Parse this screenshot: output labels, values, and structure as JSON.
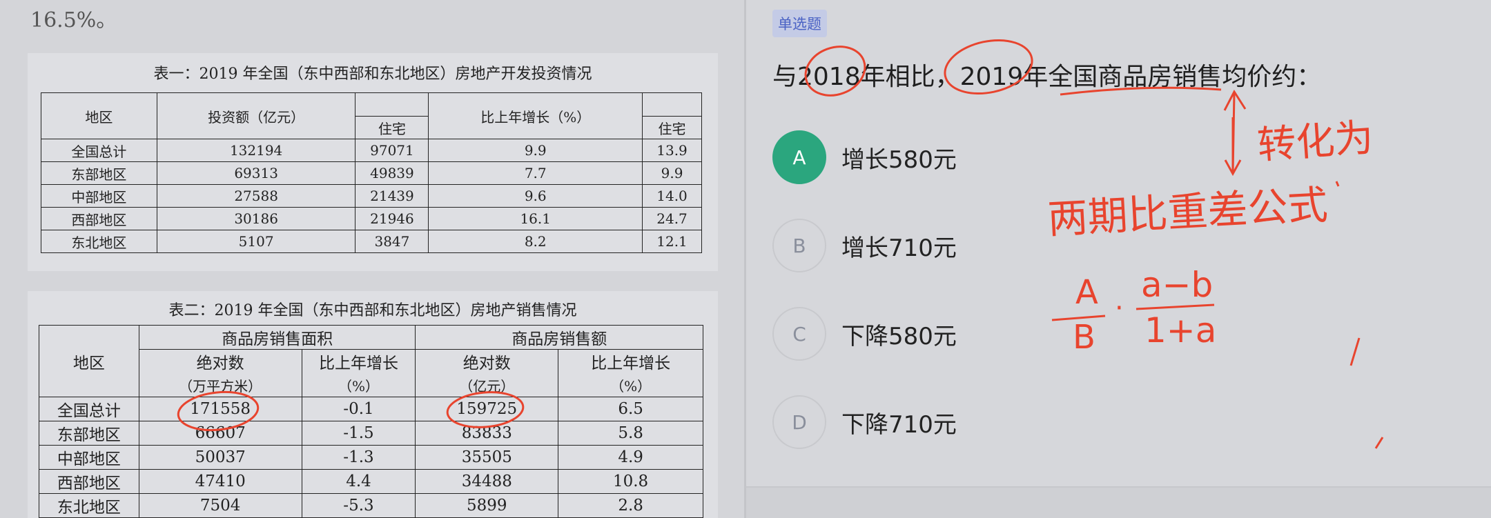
{
  "intro": {
    "text": "16.5%。"
  },
  "table1": {
    "caption": "表一：2019 年全国（东中西部和东北地区）房地产开发投资情况",
    "headers": {
      "region": "地区",
      "investment": "投资额（亿元）",
      "residential": "住宅",
      "growth": "比上年增长（%）",
      "growth_residential": "住宅"
    },
    "rows": [
      [
        "全国总计",
        "132194",
        "97071",
        "9.9",
        "13.9"
      ],
      [
        "东部地区",
        "69313",
        "49839",
        "7.7",
        "9.9"
      ],
      [
        "中部地区",
        "27588",
        "21439",
        "9.6",
        "14.0"
      ],
      [
        "西部地区",
        "30186",
        "21946",
        "16.1",
        "24.7"
      ],
      [
        "东北地区",
        "5107",
        "3847",
        "8.2",
        "12.1"
      ]
    ]
  },
  "table2": {
    "caption": "表二：2019 年全国（东中西部和东北地区）房地产销售情况",
    "headers": {
      "region": "地区",
      "area_group": "商品房销售面积",
      "amount_group": "商品房销售额",
      "area_abs": "绝对数",
      "area_abs_unit": "（万平方米）",
      "area_growth": "比上年增长",
      "area_growth_unit": "（%）",
      "amount_abs": "绝对数",
      "amount_abs_unit": "（亿元）",
      "amount_growth": "比上年增长",
      "amount_growth_unit": "（%）"
    },
    "rows": [
      [
        "全国总计",
        "171558",
        "-0.1",
        "159725",
        "6.5"
      ],
      [
        "东部地区",
        "66607",
        "-1.5",
        "83833",
        "5.8"
      ],
      [
        "中部地区",
        "50037",
        "-1.3",
        "35505",
        "4.9"
      ],
      [
        "西部地区",
        "47410",
        "4.4",
        "34488",
        "10.8"
      ],
      [
        "东北地区",
        "7504",
        "-5.3",
        "5899",
        "2.8"
      ]
    ]
  },
  "question": {
    "type_tag": "单选题",
    "text": "与2018年相比，2019年全国商品房销售均价约：",
    "options": [
      {
        "letter": "A",
        "text": "增长580元",
        "selected": true
      },
      {
        "letter": "B",
        "text": "增长710元",
        "selected": false
      },
      {
        "letter": "C",
        "text": "下降580元",
        "selected": false
      },
      {
        "letter": "D",
        "text": "下降710元",
        "selected": false
      }
    ]
  },
  "annotations": {
    "handwritten_note_1": "转化为",
    "handwritten_note_2": "两期比重差公式",
    "formula_numerator_left": "A",
    "formula_denominator_left": "B",
    "formula_dot": "·",
    "formula_numerator_right": "a−b",
    "formula_denominator_right": "1+a",
    "ink_color": "#e8442e"
  },
  "colors": {
    "selected_option": "#2ba67e",
    "tag_background": "#c4cbe6",
    "tag_text": "#4a62c4"
  }
}
